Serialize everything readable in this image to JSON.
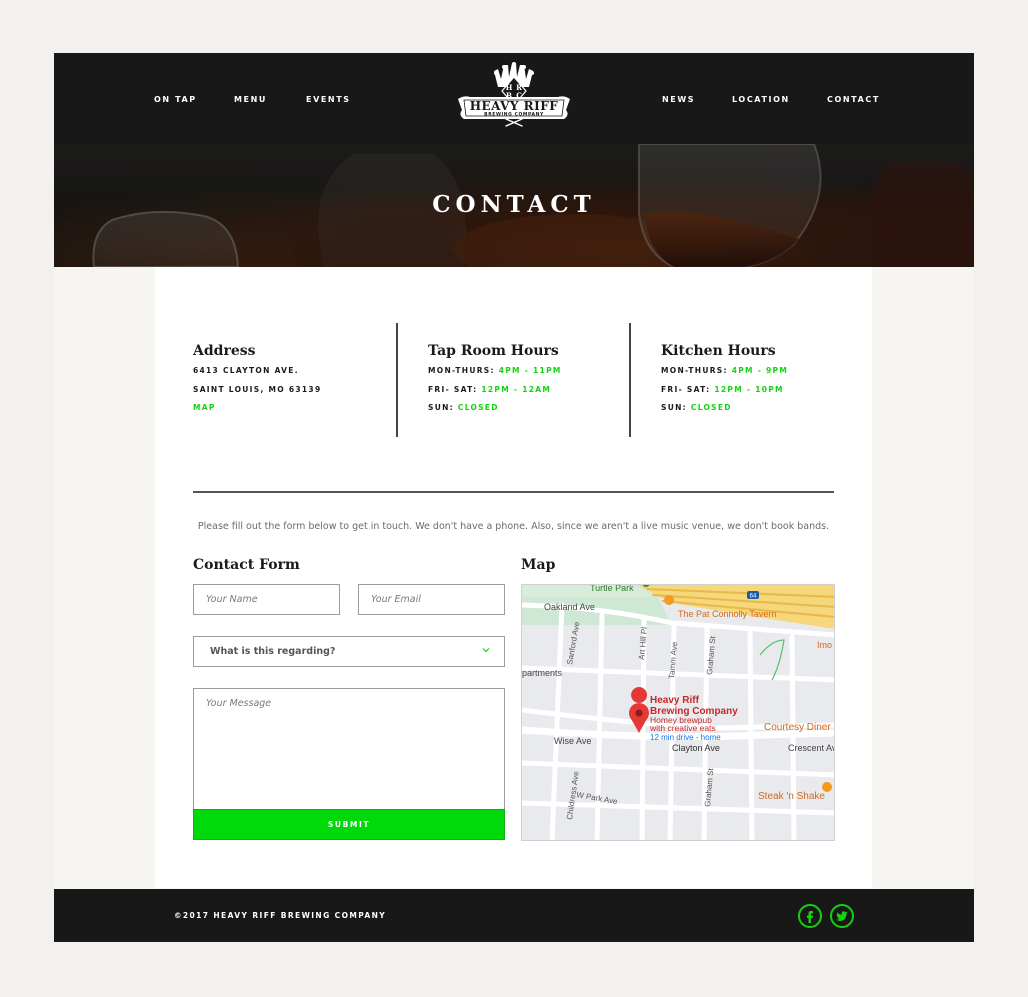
{
  "nav": {
    "left": [
      "ON TAP",
      "MENU",
      "EVENTS"
    ],
    "right": [
      "NEWS",
      "LOCATION",
      "CONTACT"
    ]
  },
  "logo": {
    "monogram": [
      "H",
      "R",
      "B",
      "C"
    ],
    "name": "HEAVY RIFF",
    "tagline": "BREWING COMPANY"
  },
  "hero": {
    "title": "CONTACT"
  },
  "address": {
    "heading": "Address",
    "line1": "6413 CLAYTON AVE.",
    "line2": "SAINT LOUIS, MO 63139",
    "map_link": "MAP"
  },
  "taproom": {
    "heading": "Tap Room Hours",
    "rows": [
      {
        "label": "MON-THURS:",
        "value": "4PM - 11PM"
      },
      {
        "label": "FRI- SAT:",
        "value": "12PM - 12AM"
      },
      {
        "label": "SUN:",
        "value": "CLOSED"
      }
    ]
  },
  "kitchen": {
    "heading": "Kitchen Hours",
    "rows": [
      {
        "label": "MON-THURS:",
        "value": "4PM - 9PM"
      },
      {
        "label": "FRI- SAT:",
        "value": "12PM - 10PM"
      },
      {
        "label": "SUN:",
        "value": "CLOSED"
      }
    ]
  },
  "intro": "Please fill out the form below to get in touch. We don't have a phone. Also, since we aren't a live music venue, we don't book bands.",
  "form": {
    "heading": "Contact Form",
    "name_placeholder": "Your Name",
    "email_placeholder": "Your Email",
    "regarding": "What is this regarding?",
    "message_placeholder": "Your Message",
    "submit": "SUBMIT"
  },
  "map": {
    "heading": "Map",
    "labels": {
      "turtle_park": "Turtle Park",
      "oakland": "Oakland Ave",
      "tavern": "The Pat Connolly Tavern",
      "imo": "Imo",
      "sanford": "Sanford Ave",
      "art_hill": "Art Hill Pl",
      "tamm": "Tamm Ave",
      "graham": "Graham St",
      "apartments": "partments",
      "place_name_1": "Heavy Riff",
      "place_name_2": "Brewing Company",
      "place_desc_1": "Homey brewpub",
      "place_desc_2": "with creative eats",
      "drive": "12 min drive - home",
      "courtesy": "Courtesy Diner",
      "wise": "Wise Ave",
      "clayton": "Clayton Ave",
      "crescent": "Crescent Av",
      "childress": "Childress Ave",
      "w_park": "W Park Ave",
      "graham2": "Graham St",
      "steak": "Steak 'n Shake",
      "hwy": "64"
    }
  },
  "footer": {
    "copyright": "©2017 HEAVY RIFF BREWING COMPANY"
  },
  "colors": {
    "accent_green": "#16d111",
    "dark": "#181818",
    "map_pin": "#e53935",
    "map_orange": "#e88f1c"
  }
}
